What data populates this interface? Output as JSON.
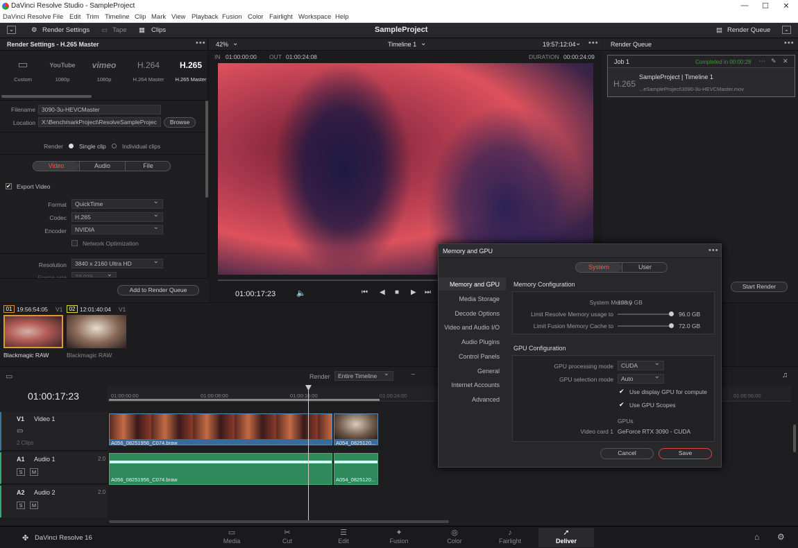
{
  "window": {
    "title": "DaVinci Resolve Studio - SampleProject",
    "min": "—",
    "max": "☐",
    "close": "✕"
  },
  "menu": [
    "DaVinci Resolve",
    "File",
    "Edit",
    "Trim",
    "Timeline",
    "Clip",
    "Mark",
    "View",
    "Playback",
    "Fusion",
    "Color",
    "Fairlight",
    "Workspace",
    "Help"
  ],
  "toolbar": {
    "render_settings": "Render Settings",
    "tape": "Tape",
    "clips": "Clips",
    "project": "SampleProject",
    "render_queue": "Render Queue"
  },
  "render_settings": {
    "title": "Render Settings - H.265 Master",
    "presets": [
      {
        "icon": "▭",
        "label": "Custom"
      },
      {
        "icon": "YouTube",
        "label": "1080p"
      },
      {
        "icon": "vimeo",
        "label": "1080p"
      },
      {
        "icon": "H.264",
        "label": "H.264 Master"
      },
      {
        "icon": "H.265",
        "label": "H.265 Master"
      }
    ],
    "filename_label": "Filename",
    "filename": "3090-3u-HEVCMaster",
    "location_label": "Location",
    "location": "X:\\BenchmarkProject\\ResolveSampleProjec",
    "browse": "Browse",
    "render_label": "Render",
    "single_clip": "Single clip",
    "individual_clips": "Individual clips",
    "tabs": [
      "Video",
      "Audio",
      "File"
    ],
    "export_video": "Export Video",
    "format_label": "Format",
    "format": "QuickTime",
    "codec_label": "Codec",
    "codec": "H.265",
    "encoder_label": "Encoder",
    "encoder": "NVIDIA",
    "network_opt": "Network Optimization",
    "resolution_label": "Resolution",
    "resolution": "3840 x 2160 Ultra HD",
    "framerate_label": "Frame rate",
    "framerate": "23.976",
    "add_queue": "Add to Render Queue"
  },
  "viewer": {
    "zoom": "42%",
    "timeline": "Timeline 1",
    "timecode": "19:57:12:04",
    "in_label": "IN",
    "in": "01:00:00:00",
    "out_label": "OUT",
    "out": "01:00:24:08",
    "duration_label": "DURATION",
    "duration": "00:00:24:09",
    "current": "01:00:17:23"
  },
  "render_queue": {
    "title": "Render Queue",
    "job": "Job 1",
    "status": "Completed in 00:00:28",
    "codec_tag": "H.265",
    "name": "SampleProject | Timeline 1",
    "path": "...eSampleProject\\3090-3u-HEVCMaster.mov",
    "start_render": "Start Render"
  },
  "clips": [
    {
      "num": "01",
      "tc": "19:56:54:05",
      "track": "V1",
      "name": "Blackmagic RAW"
    },
    {
      "num": "02",
      "tc": "12:01:40:04",
      "track": "V1",
      "name": "Blackmagic RAW"
    }
  ],
  "timeline": {
    "render_label": "Render",
    "render_mode": "Entire Timeline",
    "tc": "01:00:17:23",
    "ruler": [
      "01:00:00:00",
      "01:00:08:00",
      "01:00:16:00",
      "01:00:24:00",
      "01:00:56:00"
    ],
    "v1": {
      "id": "V1",
      "name": "Video 1",
      "clips_count": "2 Clips"
    },
    "a1": {
      "id": "A1",
      "name": "Audio 1",
      "ch": "2.0"
    },
    "a2": {
      "id": "A2",
      "name": "Audio 2",
      "ch": "2.0"
    },
    "clip1": "A056_08251956_C074.braw",
    "clip2": "A054_0825120..."
  },
  "dialog": {
    "title": "Memory and GPU",
    "tabs": [
      "System",
      "User"
    ],
    "nav": [
      "Memory and GPU",
      "Media Storage",
      "Decode Options",
      "Video and Audio I/O",
      "Audio Plugins",
      "Control Panels",
      "General",
      "Internet Accounts",
      "Advanced"
    ],
    "mem_header": "Memory Configuration",
    "sys_mem_label": "System Memory",
    "sys_mem": "128.0 GB",
    "limit_resolve_label": "Limit Resolve Memory usage to",
    "limit_resolve": "96.0 GB",
    "limit_fusion_label": "Limit Fusion Memory Cache to",
    "limit_fusion": "72.0 GB",
    "gpu_header": "GPU Configuration",
    "gpu_mode_label": "GPU processing mode",
    "gpu_mode": "CUDA",
    "gpu_sel_label": "GPU selection mode",
    "gpu_sel": "Auto",
    "use_display_gpu": "Use display GPU for compute",
    "use_gpu_scopes": "Use GPU Scopes",
    "gpus_label": "GPUs",
    "card_label": "Video card 1",
    "card": "GeForce RTX 3090 - CUDA",
    "cancel": "Cancel",
    "save": "Save"
  },
  "bottom": {
    "app": "DaVinci Resolve 16",
    "pages": [
      "Media",
      "Cut",
      "Edit",
      "Fusion",
      "Color",
      "Fairlight",
      "Deliver"
    ]
  }
}
